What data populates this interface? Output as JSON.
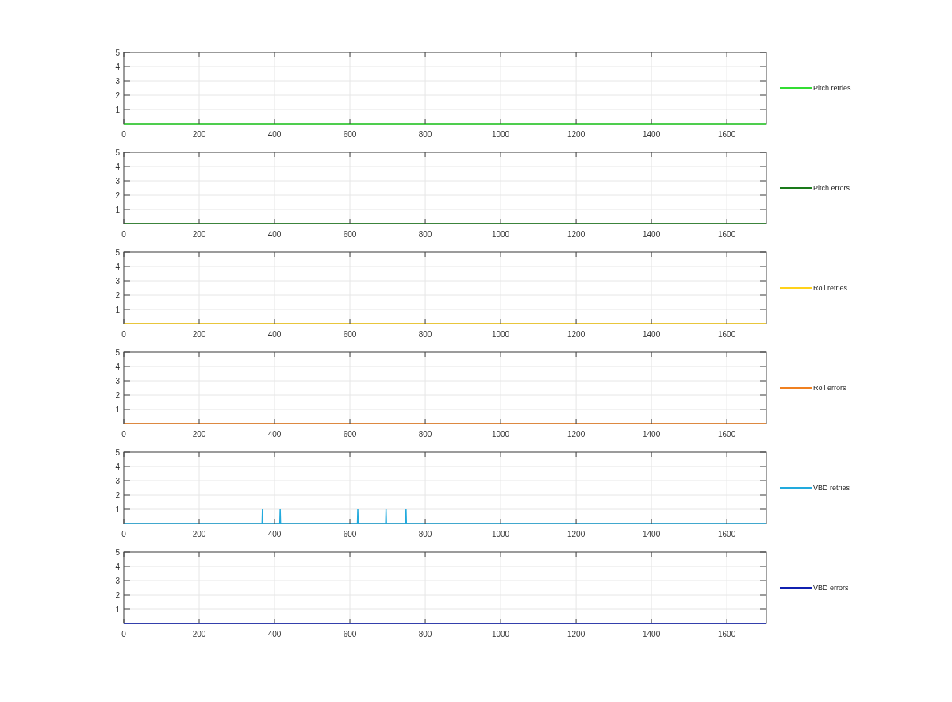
{
  "charts": [
    {
      "chart_data": {
        "type": "line",
        "x": [
          0,
          1705
        ],
        "series": [
          {
            "name": "Pitch retries",
            "color": "#33dd33",
            "values": [
              0,
              0
            ]
          }
        ],
        "xlim": [
          0,
          1705
        ],
        "ylim": [
          0,
          5
        ],
        "xticks": [
          0,
          200,
          400,
          600,
          800,
          1000,
          1200,
          1400,
          1600
        ],
        "yticks": [
          1,
          2,
          3,
          4,
          5
        ],
        "grid": true
      }
    },
    {
      "chart_data": {
        "type": "line",
        "x": [
          0,
          1705
        ],
        "series": [
          {
            "name": "Pitch errors",
            "color": "#1a7a1a",
            "values": [
              0,
              0
            ]
          }
        ],
        "xlim": [
          0,
          1705
        ],
        "ylim": [
          0,
          5
        ],
        "xticks": [
          0,
          200,
          400,
          600,
          800,
          1000,
          1200,
          1400,
          1600
        ],
        "yticks": [
          1,
          2,
          3,
          4,
          5
        ],
        "grid": true
      }
    },
    {
      "chart_data": {
        "type": "line",
        "x": [
          0,
          1705
        ],
        "series": [
          {
            "name": "Roll retries",
            "color": "#ffd21a",
            "values": [
              0,
              0
            ]
          }
        ],
        "xlim": [
          0,
          1705
        ],
        "ylim": [
          0,
          5
        ],
        "xticks": [
          0,
          200,
          400,
          600,
          800,
          1000,
          1200,
          1400,
          1600
        ],
        "yticks": [
          1,
          2,
          3,
          4,
          5
        ],
        "grid": true
      }
    },
    {
      "chart_data": {
        "type": "line",
        "x": [
          0,
          1705
        ],
        "series": [
          {
            "name": "Roll errors",
            "color": "#f08020",
            "values": [
              0,
              0
            ]
          }
        ],
        "xlim": [
          0,
          1705
        ],
        "ylim": [
          0,
          5
        ],
        "xticks": [
          0,
          200,
          400,
          600,
          800,
          1000,
          1200,
          1400,
          1600
        ],
        "yticks": [
          1,
          2,
          3,
          4,
          5
        ],
        "grid": true
      }
    },
    {
      "chart_data": {
        "type": "line",
        "x": [
          0,
          367,
          368,
          369,
          414,
          415,
          416,
          620,
          621,
          622,
          695,
          696,
          697,
          748,
          749,
          750,
          1705
        ],
        "series": [
          {
            "name": "VBD retries",
            "color": "#22aadd",
            "values": [
              0,
              0,
              1,
              0,
              0,
              1,
              0,
              0,
              1,
              0,
              0,
              1,
              0,
              0,
              1,
              0,
              0
            ]
          }
        ],
        "xlim": [
          0,
          1705
        ],
        "ylim": [
          0,
          5
        ],
        "xticks": [
          0,
          200,
          400,
          600,
          800,
          1000,
          1200,
          1400,
          1600
        ],
        "yticks": [
          1,
          2,
          3,
          4,
          5
        ],
        "grid": true
      }
    },
    {
      "chart_data": {
        "type": "line",
        "x": [
          0,
          1705
        ],
        "series": [
          {
            "name": "VBD errors",
            "color": "#1020b0",
            "values": [
              0,
              0
            ]
          }
        ],
        "xlim": [
          0,
          1705
        ],
        "ylim": [
          0,
          5
        ],
        "xticks": [
          0,
          200,
          400,
          600,
          800,
          1000,
          1200,
          1400,
          1600
        ],
        "yticks": [
          1,
          2,
          3,
          4,
          5
        ],
        "grid": true
      }
    }
  ]
}
